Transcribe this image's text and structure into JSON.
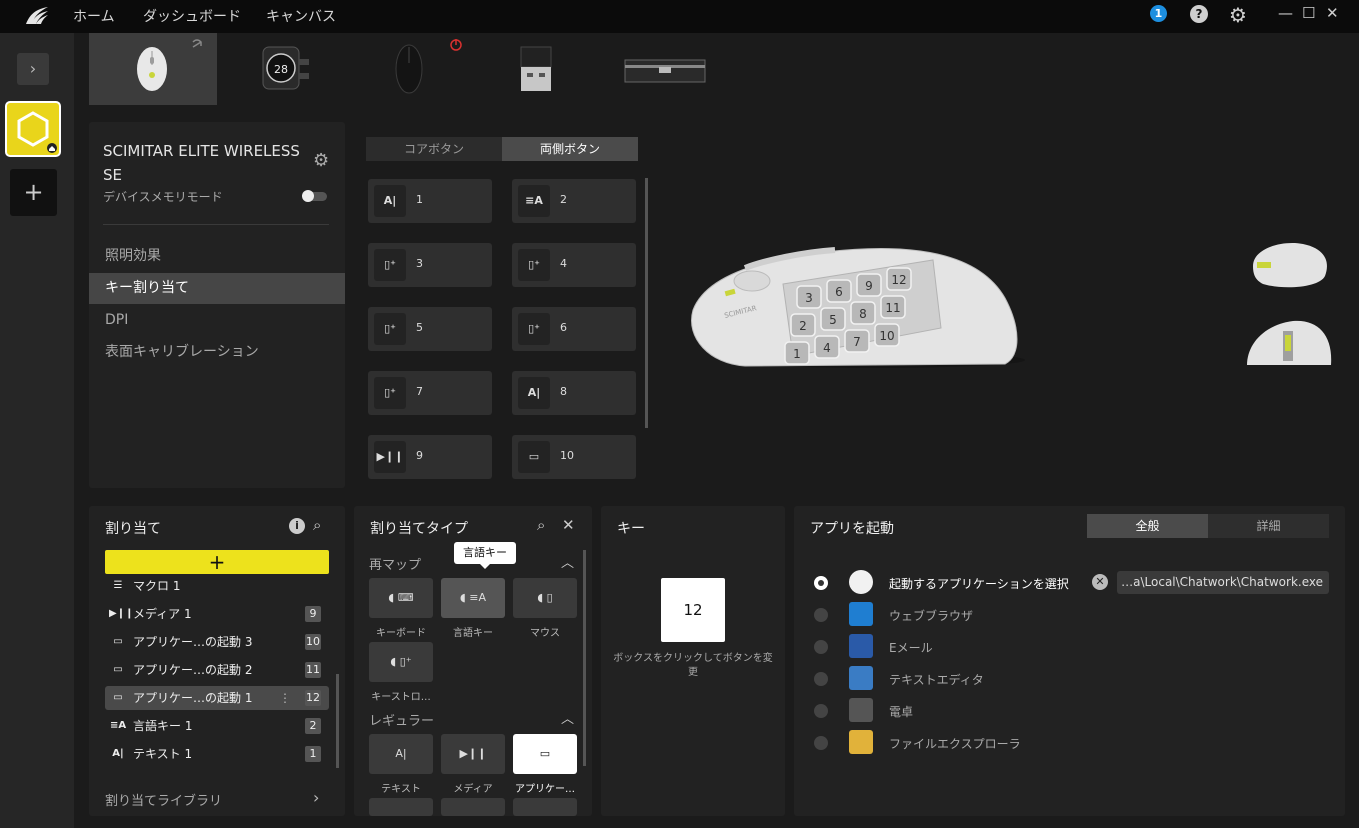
{
  "topnav": {
    "home": "ホーム",
    "dashboard": "ダッシュボード",
    "canvas": "キャンバス",
    "notification_count": "1",
    "help": "?"
  },
  "device_strip": {
    "dongle_value": "28"
  },
  "device": {
    "name": "SCIMITAR ELITE WIRELESS SE",
    "memory_mode_label": "デバイスメモリモード",
    "menu": [
      "照明効果",
      "キー割り当て",
      "DPI",
      "表面キャリブレーション"
    ],
    "selected_menu_index": 1
  },
  "button_tabs": [
    "コアボタン",
    "両側ボタン"
  ],
  "selected_tab_index": 1,
  "key_buttons": [
    {
      "icon": "text-icon",
      "label": "1"
    },
    {
      "icon": "language-icon",
      "label": "2"
    },
    {
      "icon": "keystroke-icon",
      "label": "3"
    },
    {
      "icon": "keystroke-icon",
      "label": "4"
    },
    {
      "icon": "keystroke-icon",
      "label": "5"
    },
    {
      "icon": "keystroke-icon",
      "label": "6"
    },
    {
      "icon": "keystroke-icon",
      "label": "7"
    },
    {
      "icon": "text-icon",
      "label": "8"
    },
    {
      "icon": "media-icon",
      "label": "9"
    },
    {
      "icon": "app-launch-icon",
      "label": "10"
    }
  ],
  "mouse_keypad": [
    "3",
    "6",
    "9",
    "12",
    "2",
    "5",
    "8",
    "11",
    "1",
    "4",
    "7",
    "10"
  ],
  "assignments": {
    "title": "割り当て",
    "add_label": "+",
    "items": [
      {
        "icon": "macro-icon",
        "label": "マクロ 1",
        "num": ""
      },
      {
        "icon": "media-icon",
        "label": "メディア 1",
        "num": "9"
      },
      {
        "icon": "app-launch-icon",
        "label": "アプリケー…の起動 3",
        "num": "10"
      },
      {
        "icon": "app-launch-icon",
        "label": "アプリケー…の起動 2",
        "num": "11"
      },
      {
        "icon": "app-launch-icon",
        "label": "アプリケー…の起動 1",
        "num": "12"
      },
      {
        "icon": "language-icon",
        "label": "言語キー 1",
        "num": "2"
      },
      {
        "icon": "text-icon",
        "label": "テキスト 1",
        "num": "1"
      }
    ],
    "selected_index": 4,
    "library_label": "割り当てライブラリ"
  },
  "assign_type": {
    "title": "割り当てタイプ",
    "remap_section": "再マップ",
    "tooltip": "言語キー",
    "remap_items": [
      {
        "icon": "keyboard-icon",
        "caption": "キーボード"
      },
      {
        "icon": "language-icon",
        "caption": "言語キー"
      },
      {
        "icon": "mouse-icon",
        "caption": "マウス"
      },
      {
        "icon": "keystroke-icon",
        "caption": "キーストロ…"
      }
    ],
    "regular_section": "レギュラー",
    "regular_items": [
      {
        "icon": "text-icon",
        "caption": "テキスト"
      },
      {
        "icon": "media-icon",
        "caption": "メディア"
      },
      {
        "icon": "app-launch-icon",
        "caption": "アプリケー…"
      }
    ]
  },
  "key_panel": {
    "title": "キー",
    "value": "12",
    "hint": "ボックスをクリックしてボタンを変更"
  },
  "app_panel": {
    "title": "アプリを起動",
    "tabs": [
      "全般",
      "詳細"
    ],
    "selected_tab_index": 0,
    "options": [
      {
        "icon": "chatwork-icon",
        "label": "起動するアプリケーションを選択"
      },
      {
        "icon": "browser-icon",
        "label": "ウェブブラウザ"
      },
      {
        "icon": "email-icon",
        "label": "Eメール"
      },
      {
        "icon": "text-editor-icon",
        "label": "テキストエディタ"
      },
      {
        "icon": "calculator-icon",
        "label": "電卓"
      },
      {
        "icon": "folder-icon",
        "label": "ファイルエクスプローラ"
      }
    ],
    "selected_index": 0,
    "path": "…a\\Local\\Chatwork\\Chatwork.exe"
  }
}
